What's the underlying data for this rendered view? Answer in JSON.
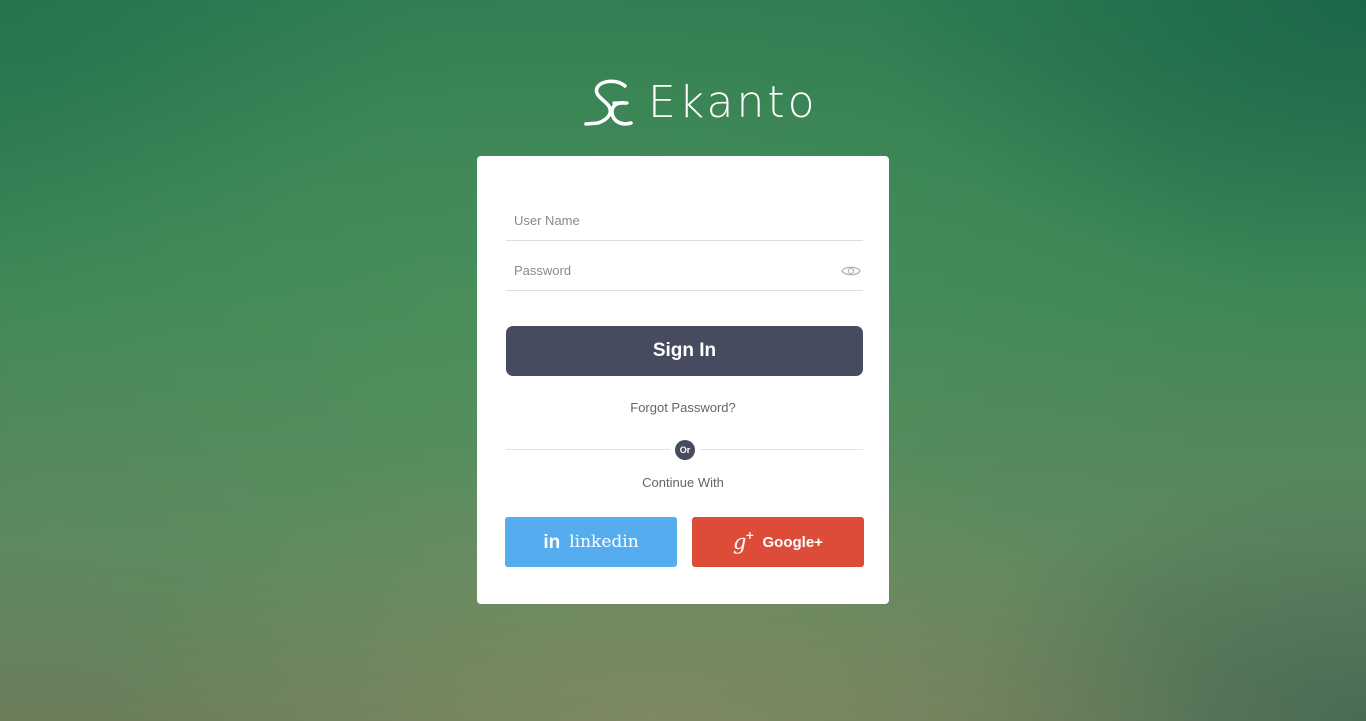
{
  "brand": {
    "name": "Ekanto",
    "logo_icon": "ekanto-logo-icon"
  },
  "login_form": {
    "username_placeholder": "User Name",
    "password_placeholder": "Password",
    "show_password_icon": "eye-icon",
    "sign_in_label": "Sign In",
    "forgot_password_label": "Forgot Password?",
    "divider_label": "Or",
    "continue_with_label": "Continue With"
  },
  "social_login": {
    "linkedin": {
      "label": "linkedin",
      "icon": "linkedin-icon",
      "icon_text": "in",
      "color": "#55acee"
    },
    "google": {
      "label": "Google+",
      "icon": "google-plus-icon",
      "icon_text": "g",
      "icon_plus": "+",
      "color": "#dd4b39"
    }
  },
  "colors": {
    "primary_button": "#464b5f",
    "card_background": "#ffffff"
  }
}
